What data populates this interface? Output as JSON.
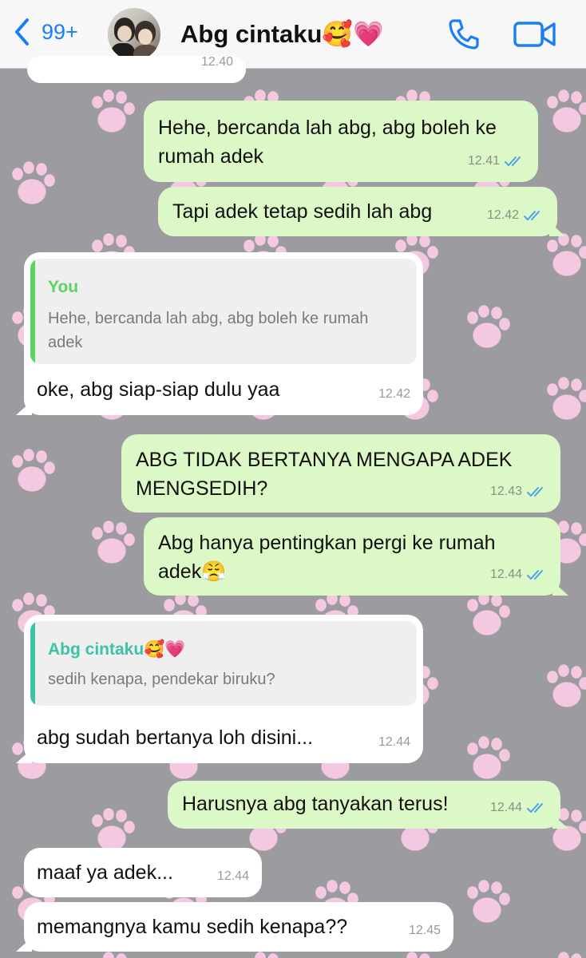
{
  "header": {
    "back_count": "99+",
    "contact_name": "Abg cintaku🥰💗"
  },
  "colors": {
    "accent": "#1a7ff5",
    "outgoing_bubble": "#dcf8c6",
    "incoming_bubble": "#ffffff",
    "read_ticks": "#4aa3f0",
    "quote_you": "#5bd35f",
    "quote_contact": "#3cc2a6",
    "wallpaper": "#9c9b9f",
    "paw": "#f4c8e0"
  },
  "messages": [
    {
      "id": "m0",
      "text": "",
      "time": "12.40"
    },
    {
      "id": "m1",
      "text_line1": "Hehe, bercanda lah abg, abg boleh ke",
      "text_line2": "rumah adek",
      "time": "12.41",
      "status_icon": "double-check-read"
    },
    {
      "id": "m2",
      "text": "Tapi adek tetap sedih lah abg",
      "time": "12.42",
      "status_icon": "double-check-read"
    },
    {
      "id": "m3",
      "quote_author": "You",
      "quote_line1": "Hehe, bercanda lah abg, abg boleh ke rumah",
      "quote_line2": "adek",
      "text": "oke, abg siap-siap dulu yaa",
      "time": "12.42"
    },
    {
      "id": "m4",
      "text_line1": "ABG TIDAK BERTANYA MENGAPA ADEK",
      "text_line2": "MENGSEDIH?",
      "time": "12.43",
      "status_icon": "double-check-read"
    },
    {
      "id": "m5",
      "text_line1": "Abg hanya pentingkan pergi ke rumah",
      "text_line2": "adek😤",
      "time": "12.44",
      "status_icon": "double-check-read"
    },
    {
      "id": "m6",
      "quote_author": "Abg cintaku🥰💗",
      "quote_line1": "sedih kenapa, pendekar biruku?",
      "text": "abg sudah bertanya loh disini...",
      "time": "12.44"
    },
    {
      "id": "m7",
      "text": "Harusnya abg tanyakan terus!",
      "time": "12.44",
      "status_icon": "double-check-read"
    },
    {
      "id": "m8",
      "text": "maaf ya adek...",
      "time": "12.44"
    },
    {
      "id": "m9",
      "text": "memangnya kamu sedih kenapa??",
      "time": "12.45"
    }
  ]
}
